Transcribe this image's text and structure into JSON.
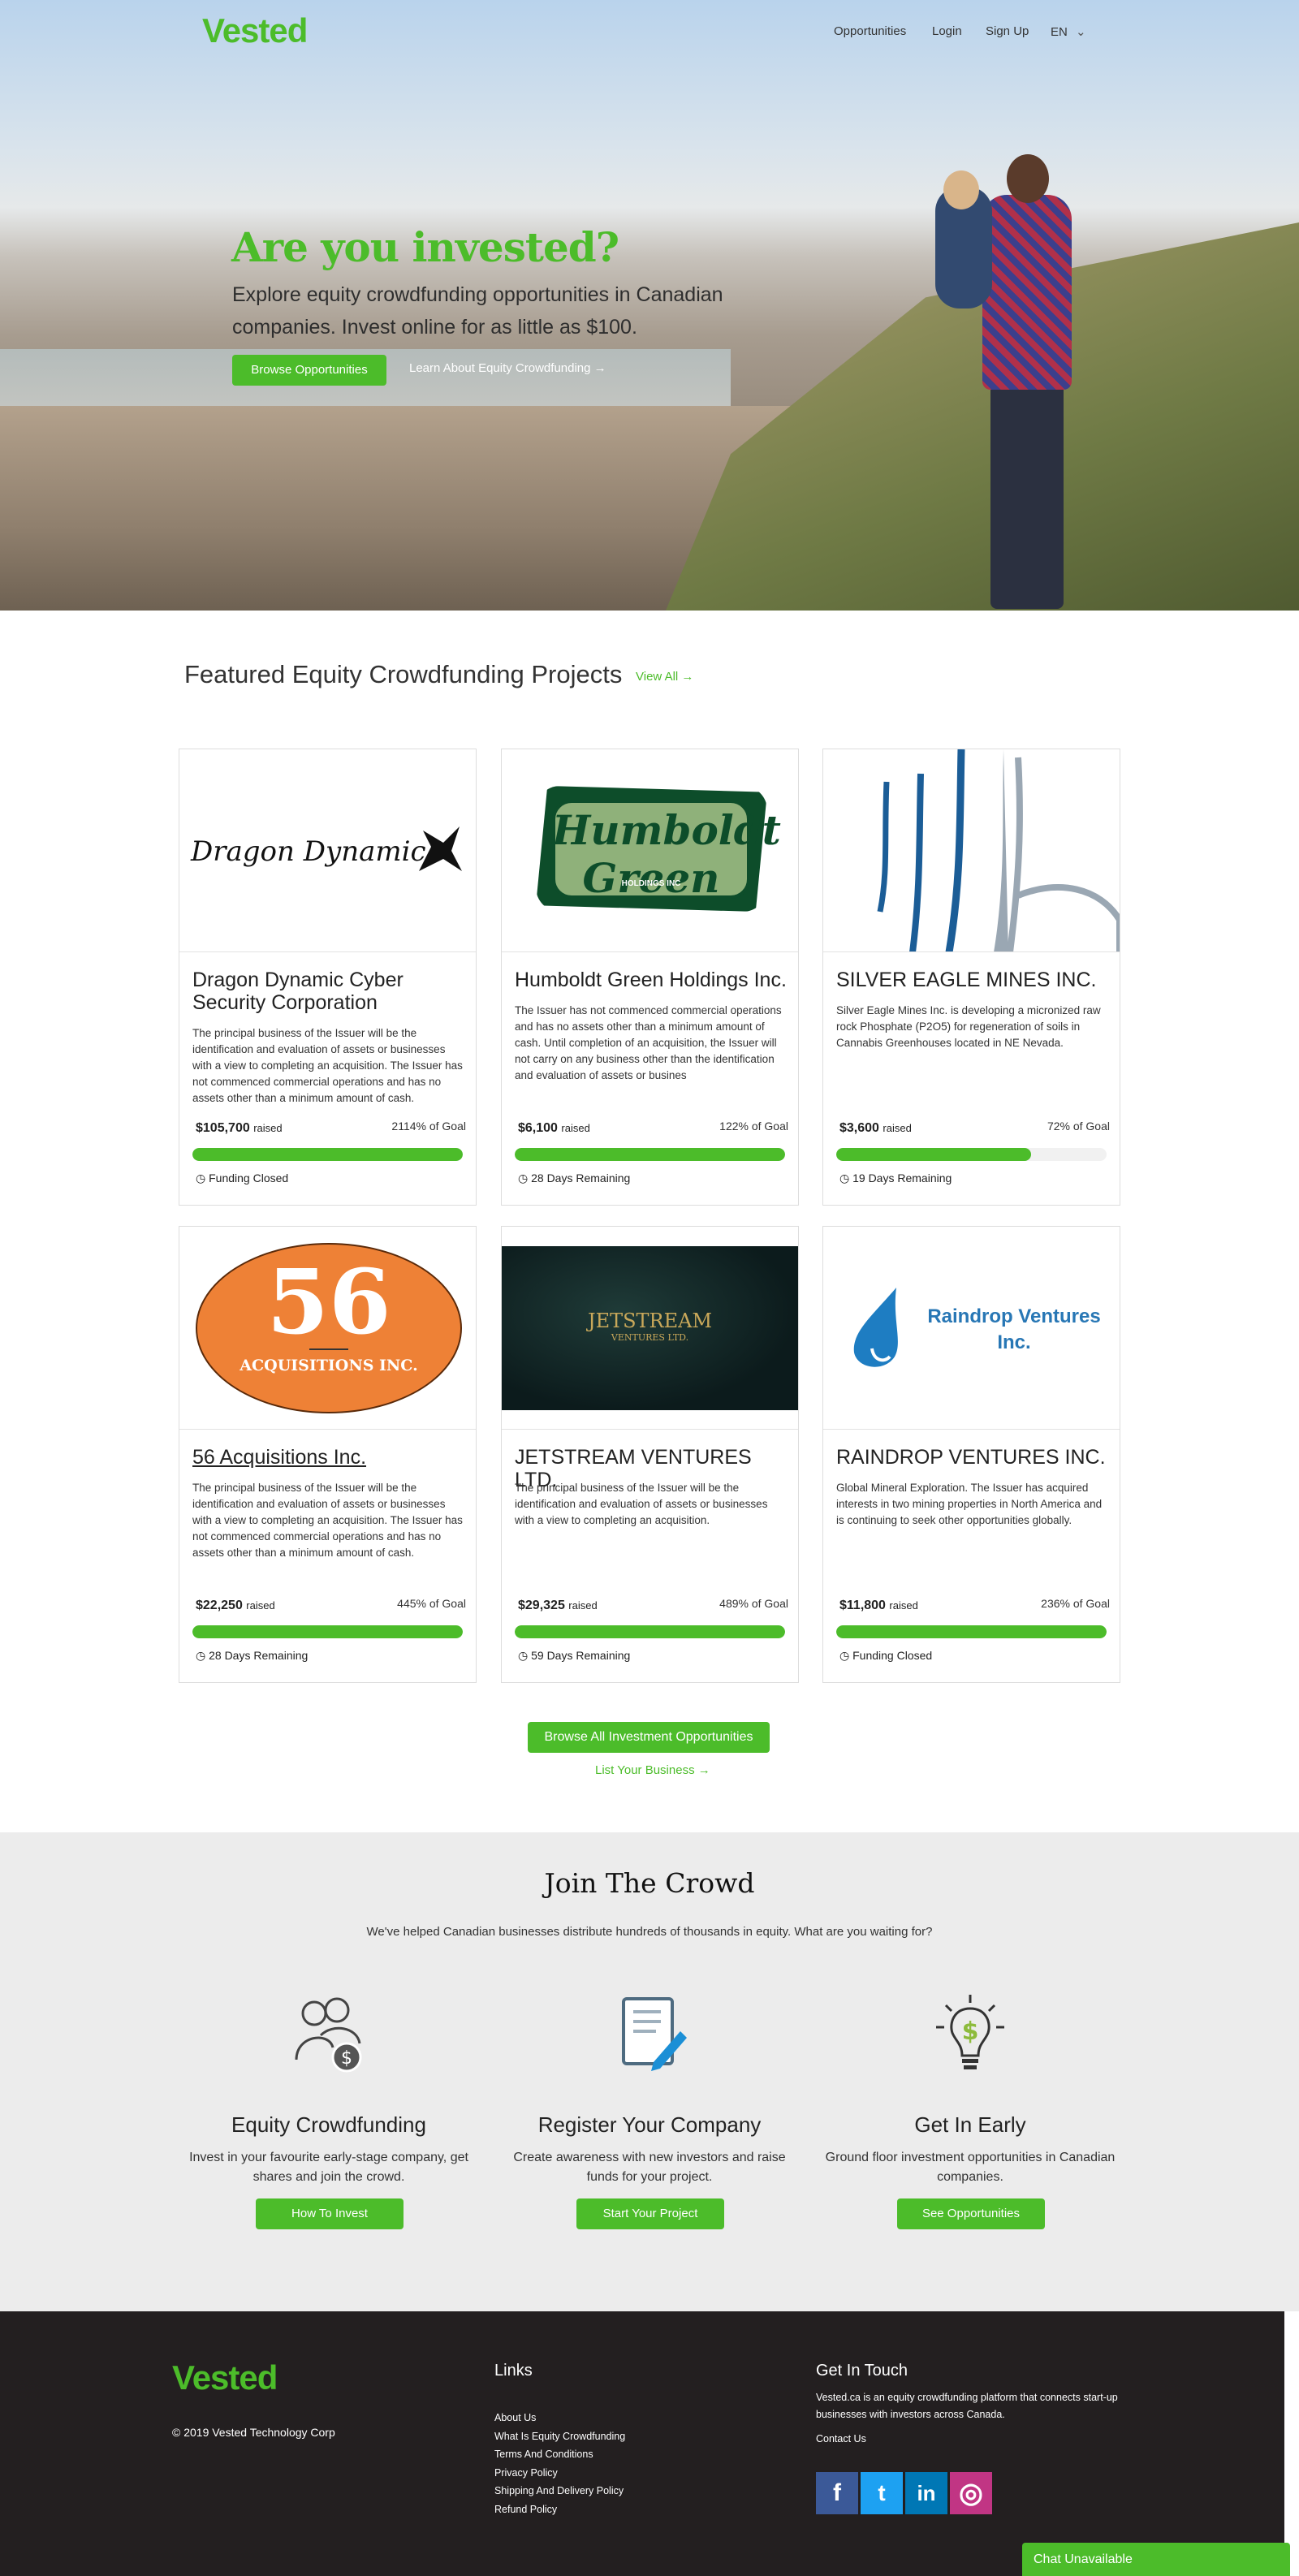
{
  "header": {
    "logo": "Vested",
    "nav": [
      "Opportunities",
      "Login",
      "Sign Up",
      "EN"
    ]
  },
  "hero": {
    "title": "Are you invested?",
    "subtitle": "Explore equity crowdfunding opportunities in Canadian companies. Invest online for as little as $100.",
    "browse_button": "Browse Opportunities",
    "learn_link": "Learn About Equity Crowdfunding →"
  },
  "featured": {
    "title": "Featured Equity Crowdfunding Projects",
    "view_all": "View All →",
    "raised_label": "raised",
    "cards": [
      {
        "logo_text": "Dragon Dynamic",
        "name": "Dragon Dynamic Cyber Security Corporation",
        "description": "The principal business of the Issuer will be the identification and evaluation of assets or businesses with a view to completing an acquisition. The Issuer has not commenced commercial operations and has no assets other than a minimum amount of cash.",
        "raised": "$105,700",
        "goal": "2114% of Goal",
        "progress": 1.0,
        "status": "Funding Closed"
      },
      {
        "logo_text": "Humboldt Green",
        "logo_sub": "HOLDINGS INC",
        "name": "Humboldt Green Holdings Inc.",
        "description": "The Issuer has not commenced commercial operations and has no assets other than a minimum amount of cash. Until completion of an acquisition, the Issuer will not carry on any business other than the identification and evaluation of assets or busines",
        "raised": "$6,100",
        "goal": "122% of Goal",
        "progress": 1.0,
        "status": "28 Days Remaining"
      },
      {
        "logo_text": "",
        "name": "SILVER EAGLE MINES INC.",
        "description": "Silver Eagle Mines Inc. is developing a micronized raw rock Phosphate (P2O5) for regeneration of soils in Cannabis Greenhouses located in NE Nevada.",
        "raised": "$3,600",
        "goal": "72% of Goal",
        "progress": 0.72,
        "status": "19 Days Remaining"
      },
      {
        "logo_text": "56",
        "logo_sub": "ACQUISITIONS INC.",
        "name": "56 Acquisitions Inc.",
        "description": "The principal business of the Issuer will be the identification and evaluation of assets or businesses with a view to completing an acquisition. The Issuer has not commenced commercial operations and has no assets other than a minimum amount of cash.",
        "raised": "$22,250",
        "goal": "445% of Goal",
        "progress": 1.0,
        "status": "28 Days Remaining"
      },
      {
        "logo_text": "JETSTREAM",
        "logo_sub": "VENTURES LTD.",
        "name": "JETSTREAM VENTURES LTD.",
        "description": "The principal business of the Issuer will be the identification and evaluation of assets or businesses with a view to completing an acquisition.",
        "raised": "$29,325",
        "goal": "489% of Goal",
        "progress": 1.0,
        "status": "59 Days Remaining"
      },
      {
        "logo_text": "Raindrop Ventures",
        "logo_sub": "Inc.",
        "name": "RAINDROP VENTURES INC.",
        "description": "Global Mineral Exploration. The Issuer has acquired interests in two mining properties in North America and is continuing to seek other opportunities globally.",
        "raised": "$11,800",
        "goal": "236% of Goal",
        "progress": 1.0,
        "status": "Funding Closed"
      }
    ],
    "browse_all": "Browse All Investment Opportunities",
    "list_business": "List Your Business →"
  },
  "join": {
    "title": "Join The Crowd",
    "lead": "We've helped Canadian businesses distribute hundreds of thousands in equity. What are you waiting for?",
    "features": [
      {
        "icon": "crowd-dollar-icon",
        "title": "Equity Crowdfunding",
        "description": "Invest in your favourite early-stage company, get shares and join the crowd.",
        "button": "How To Invest"
      },
      {
        "icon": "document-pen-icon",
        "title": "Register Your Company",
        "description": "Create awareness with new investors and raise funds for your project.",
        "button": "Start Your Project"
      },
      {
        "icon": "lightbulb-dollar-icon",
        "title": "Get In Early",
        "description": "Ground floor investment opportunities in Canadian companies.",
        "button": "See Opportunities"
      }
    ]
  },
  "footer": {
    "logo": "Vested",
    "copyright": "© 2019 Vested Technology Corp",
    "links_title": "Links",
    "links": [
      "About Us",
      "What Is Equity Crowdfunding",
      "Terms And Conditions",
      "Privacy Policy",
      "Shipping And Delivery Policy",
      "Refund Policy"
    ],
    "contact_title": "Get In Touch",
    "contact_text": "Vested.ca is an equity crowdfunding platform that connects start-up businesses with investors across Canada.",
    "contact_link": "Contact Us",
    "social": [
      {
        "name": "facebook-icon",
        "glyph": "f",
        "color": "#3b5998"
      },
      {
        "name": "twitter-icon",
        "glyph": "t",
        "color": "#1da1f2"
      },
      {
        "name": "linkedin-icon",
        "glyph": "in",
        "color": "#0077b5"
      },
      {
        "name": "instagram-icon",
        "glyph": "◎",
        "color": "#c13584"
      }
    ]
  },
  "chat": {
    "label": "Chat Unavailable"
  },
  "colors": {
    "brand_green": "#4cbc2a",
    "footer_bg": "#231f20",
    "section_bg": "#ececec"
  }
}
